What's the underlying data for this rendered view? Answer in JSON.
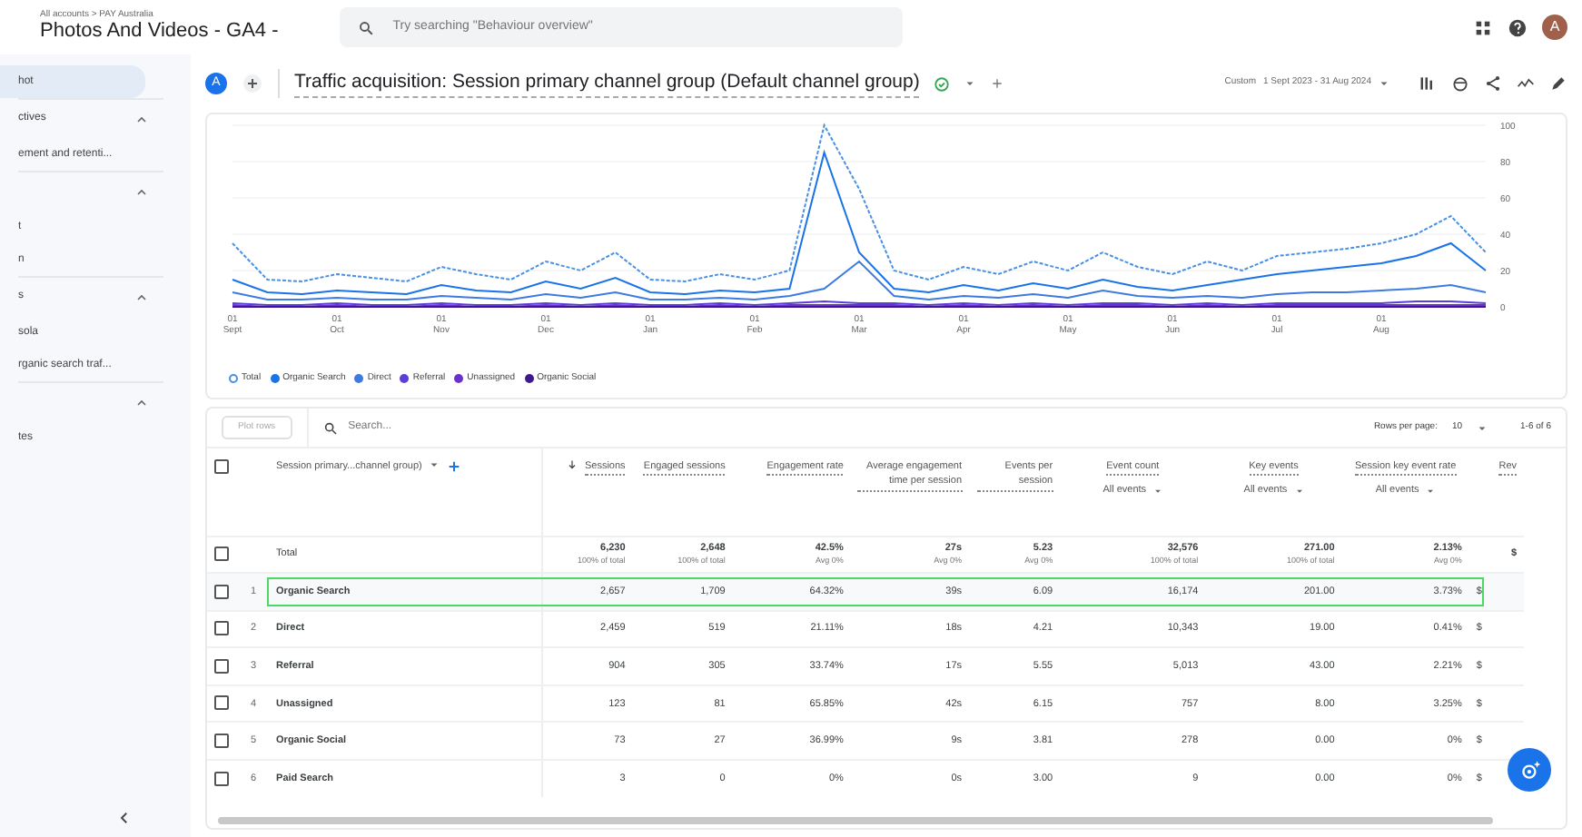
{
  "topbar": {
    "breadcrumb": "All accounts > PAY Australia",
    "property": "Photos And Videos - GA4 -",
    "search": {
      "placeholder": "Try searching \"Behaviour overview\""
    },
    "avatar": "A"
  },
  "sidebar": {
    "items": [
      {
        "label": "hot",
        "kind": "item",
        "selected": true
      },
      {
        "label": "ctives",
        "kind": "section",
        "expanded": true
      },
      {
        "label": "ement and retenti...",
        "kind": "item",
        "selected": false
      },
      {
        "kind": "section",
        "expanded": true
      },
      {
        "label": "t",
        "kind": "item",
        "selected": false
      },
      {
        "label": "n",
        "kind": "item",
        "selected": false
      },
      {
        "label": "s",
        "kind": "section",
        "expanded": true
      },
      {
        "label": "sola",
        "kind": "item",
        "selected": false
      },
      {
        "label": "rganic search traf...",
        "kind": "item",
        "selected": false
      },
      {
        "kind": "section",
        "expanded": true
      },
      {
        "label": "tes",
        "kind": "item",
        "selected": false
      }
    ]
  },
  "report": {
    "badge": "A",
    "title": "Traffic acquisition: Session primary channel group (Default channel group)",
    "date_label": "Custom",
    "date_range": "1 Sept 2023 - 31 Aug 2024"
  },
  "chart": {
    "chart_data": {
      "type": "line",
      "categories": [
        "01 Sept",
        null,
        null,
        "01 Oct",
        null,
        null,
        "01 Nov",
        null,
        null,
        "01 Dec",
        null,
        null,
        "01 Jan",
        null,
        null,
        "01 Feb",
        null,
        null,
        "01 Mar",
        null,
        null,
        "01 Apr",
        null,
        null,
        "01 May",
        null,
        null,
        "01 Jun",
        null,
        null,
        "01 Jul",
        null,
        null,
        "01 Aug",
        null,
        null,
        null
      ],
      "ylim": [
        0,
        100
      ],
      "yticks": [
        0,
        20,
        40,
        60,
        80,
        100
      ],
      "grid": true,
      "series": [
        {
          "name": "Total",
          "color": "#4a90e2",
          "line_style": "dashed",
          "values": [
            35,
            15,
            14,
            18,
            16,
            14,
            22,
            18,
            15,
            25,
            20,
            30,
            15,
            14,
            18,
            15,
            20,
            100,
            65,
            20,
            15,
            22,
            18,
            25,
            20,
            30,
            22,
            18,
            25,
            20,
            28,
            30,
            32,
            35,
            40,
            50,
            30
          ]
        },
        {
          "name": "Organic Search",
          "color": "#1a73e8",
          "line_style": "solid",
          "values": [
            15,
            8,
            7,
            9,
            8,
            7,
            12,
            9,
            8,
            14,
            10,
            16,
            8,
            7,
            9,
            8,
            10,
            85,
            30,
            10,
            8,
            12,
            9,
            13,
            10,
            15,
            11,
            9,
            12,
            15,
            18,
            20,
            22,
            24,
            28,
            35,
            20
          ]
        },
        {
          "name": "Direct",
          "color": "#3d7be0",
          "line_style": "solid",
          "values": [
            8,
            4,
            4,
            5,
            4,
            4,
            6,
            5,
            4,
            7,
            5,
            8,
            4,
            4,
            5,
            4,
            6,
            10,
            25,
            6,
            4,
            6,
            5,
            7,
            5,
            9,
            6,
            5,
            6,
            5,
            7,
            8,
            8,
            9,
            10,
            12,
            8
          ]
        },
        {
          "name": "Referral",
          "color": "#5c3dd9",
          "line_style": "solid",
          "values": [
            2,
            1,
            1,
            2,
            1,
            1,
            2,
            1,
            1,
            2,
            1,
            2,
            1,
            1,
            2,
            1,
            2,
            3,
            2,
            2,
            1,
            2,
            1,
            2,
            1,
            2,
            2,
            1,
            2,
            1,
            2,
            2,
            2,
            2,
            3,
            3,
            2
          ]
        },
        {
          "name": "Unassigned",
          "color": "#6a32c9",
          "line_style": "solid",
          "values": [
            1,
            0,
            0,
            1,
            0,
            0,
            1,
            0,
            0,
            1,
            0,
            1,
            0,
            0,
            1,
            0,
            1,
            1,
            1,
            1,
            0,
            1,
            0,
            1,
            0,
            1,
            1,
            0,
            1,
            0,
            1,
            1,
            1,
            1,
            1,
            1,
            1
          ]
        },
        {
          "name": "Organic Social",
          "color": "#3b1a8c",
          "line_style": "solid",
          "values": [
            0,
            0,
            0,
            0,
            0,
            0,
            0,
            0,
            0,
            0,
            0,
            0,
            0,
            0,
            0,
            0,
            0,
            0,
            0,
            0,
            0,
            0,
            0,
            0,
            0,
            0,
            0,
            0,
            0,
            0,
            0,
            0,
            0,
            0,
            0,
            0,
            0
          ]
        }
      ]
    }
  },
  "table": {
    "plot_rows": {
      "label": "Plot rows",
      "disabled": true
    },
    "search": {
      "placeholder": "Search..."
    },
    "rows_per_page_label": "Rows per page:",
    "rows_per_page": "10",
    "pagination": "1-6 of 6",
    "header_checked": false,
    "columns": [
      {
        "label": "Session primary...channel group)",
        "kind": "dimension"
      },
      {
        "label": "Sessions",
        "kind": "metric",
        "sorted": true
      },
      {
        "label": "Engaged sessions",
        "kind": "metric",
        "sorted": false
      },
      {
        "label": "Engagement rate",
        "kind": "metric",
        "sorted": false
      },
      {
        "label": "Average engagement time per session",
        "kind": "metric",
        "sorted": false
      },
      {
        "label": "Events per session",
        "kind": "metric",
        "sorted": false
      },
      {
        "label": "Event count",
        "kind": "metric",
        "sorted": false,
        "filter": "All events"
      },
      {
        "label": "Key events",
        "kind": "metric",
        "sorted": false,
        "filter": "All events"
      },
      {
        "label": "Session key event rate",
        "kind": "metric",
        "sorted": false,
        "filter": "All events"
      },
      {
        "label": "Rev",
        "kind": "metric",
        "sorted": false
      }
    ],
    "total": {
      "label": "Total",
      "checked": false,
      "values": [
        [
          "6,230",
          "100% of total"
        ],
        [
          "2,648",
          "100% of total"
        ],
        [
          "42.5%",
          "Avg 0%"
        ],
        [
          "27s",
          "Avg 0%"
        ],
        [
          "5.23",
          "Avg 0%"
        ],
        [
          "32,576",
          "100% of total"
        ],
        [
          "271.00",
          "100% of total"
        ],
        [
          "2.13%",
          "Avg 0%"
        ],
        [
          "$"
        ]
      ]
    },
    "rows": [
      {
        "index": "1",
        "label": "Organic Search",
        "checked": false,
        "highlighted": true,
        "values": [
          "2,657",
          "1,709",
          "64.32%",
          "39s",
          "6.09",
          "16,174",
          "201.00",
          "3.73%",
          "$"
        ]
      },
      {
        "index": "2",
        "label": "Direct",
        "checked": false,
        "highlighted": false,
        "values": [
          "2,459",
          "519",
          "21.11%",
          "18s",
          "4.21",
          "10,343",
          "19.00",
          "0.41%",
          "$"
        ]
      },
      {
        "index": "3",
        "label": "Referral",
        "checked": false,
        "highlighted": false,
        "values": [
          "904",
          "305",
          "33.74%",
          "17s",
          "5.55",
          "5,013",
          "43.00",
          "2.21%",
          "$"
        ]
      },
      {
        "index": "4",
        "label": "Unassigned",
        "checked": false,
        "highlighted": false,
        "values": [
          "123",
          "81",
          "65.85%",
          "42s",
          "6.15",
          "757",
          "8.00",
          "3.25%",
          "$"
        ]
      },
      {
        "index": "5",
        "label": "Organic Social",
        "checked": false,
        "highlighted": false,
        "values": [
          "73",
          "27",
          "36.99%",
          "9s",
          "3.81",
          "278",
          "0.00",
          "0%",
          "$"
        ]
      },
      {
        "index": "6",
        "label": "Paid Search",
        "checked": false,
        "highlighted": false,
        "values": [
          "3",
          "0",
          "0%",
          "0s",
          "3.00",
          "9",
          "0.00",
          "0%",
          "$"
        ]
      }
    ]
  }
}
